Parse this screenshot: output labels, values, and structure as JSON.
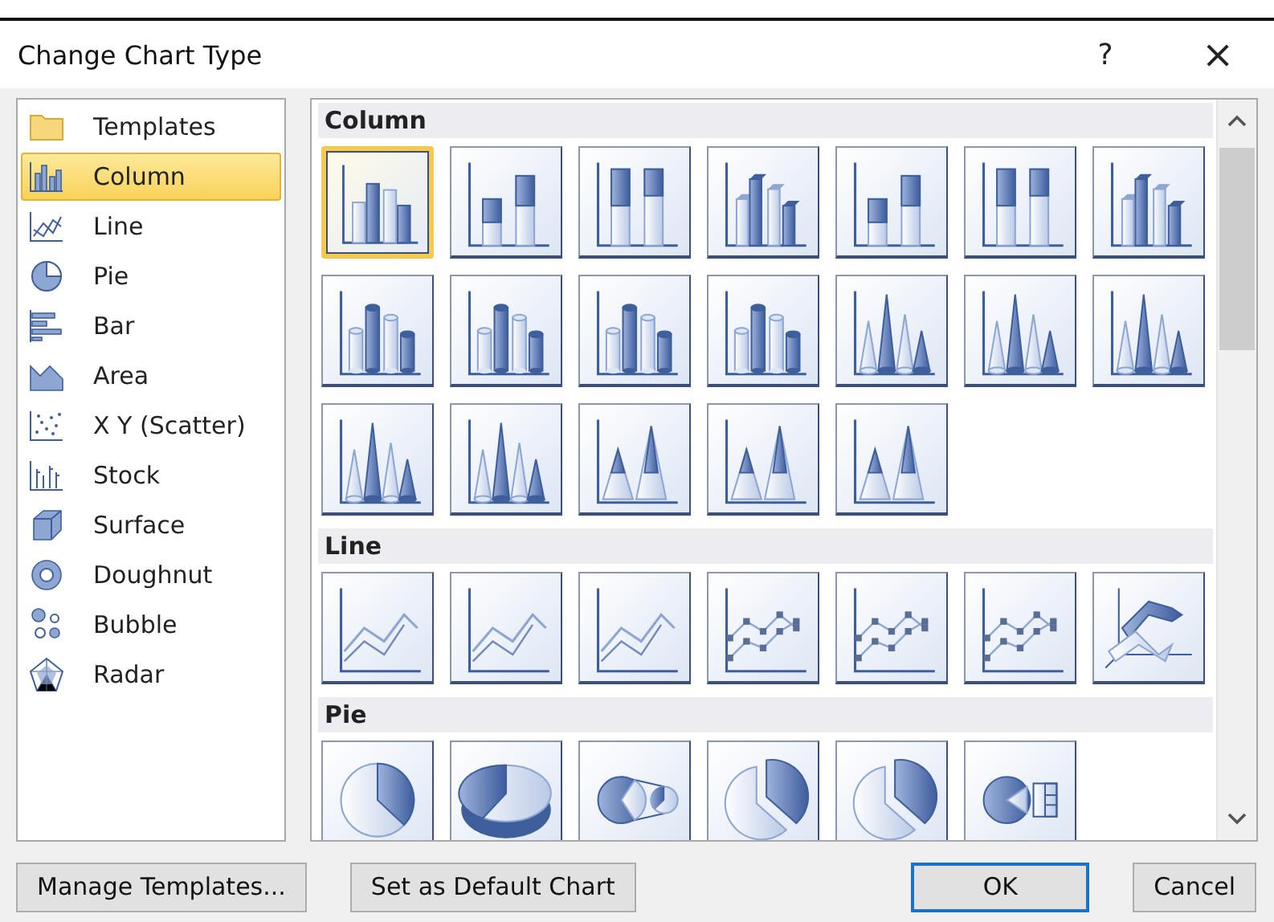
{
  "window": {
    "title": "Change Chart Type",
    "help": "?",
    "close": "×"
  },
  "sidebar": {
    "items": [
      {
        "label": "Templates",
        "kind": "templates",
        "selected": false
      },
      {
        "label": "Column",
        "kind": "column",
        "selected": true
      },
      {
        "label": "Line",
        "kind": "line",
        "selected": false
      },
      {
        "label": "Pie",
        "kind": "pie",
        "selected": false
      },
      {
        "label": "Bar",
        "kind": "bar",
        "selected": false
      },
      {
        "label": "Area",
        "kind": "area",
        "selected": false
      },
      {
        "label": "X Y (Scatter)",
        "kind": "scatter",
        "selected": false
      },
      {
        "label": "Stock",
        "kind": "stock",
        "selected": false
      },
      {
        "label": "Surface",
        "kind": "surface",
        "selected": false
      },
      {
        "label": "Doughnut",
        "kind": "doughnut",
        "selected": false
      },
      {
        "label": "Bubble",
        "kind": "bubble",
        "selected": false
      },
      {
        "label": "Radar",
        "kind": "radar",
        "selected": false
      }
    ]
  },
  "gallery": [
    {
      "title": "Column",
      "items": [
        {
          "kind": "column",
          "selected": true
        },
        {
          "kind": "stackedcolumn",
          "selected": false
        },
        {
          "kind": "fullcolumn",
          "selected": false
        },
        {
          "kind": "column3d",
          "selected": false
        },
        {
          "kind": "stackedcolumn",
          "selected": false
        },
        {
          "kind": "fullcolumn",
          "selected": false
        },
        {
          "kind": "column3d",
          "selected": false
        },
        {
          "kind": "cylinder",
          "selected": false
        },
        {
          "kind": "cylinder",
          "selected": false
        },
        {
          "kind": "cylinder",
          "selected": false
        },
        {
          "kind": "cylinder",
          "selected": false
        },
        {
          "kind": "cone",
          "selected": false
        },
        {
          "kind": "cone",
          "selected": false
        },
        {
          "kind": "cone",
          "selected": false
        },
        {
          "kind": "cone",
          "selected": false
        },
        {
          "kind": "cone",
          "selected": false
        },
        {
          "kind": "pyramid",
          "selected": false
        },
        {
          "kind": "pyramid",
          "selected": false
        },
        {
          "kind": "pyramid",
          "selected": false
        }
      ]
    },
    {
      "title": "Line",
      "items": [
        {
          "kind": "line",
          "selected": false
        },
        {
          "kind": "line",
          "selected": false
        },
        {
          "kind": "line",
          "selected": false
        },
        {
          "kind": "markerline",
          "selected": false
        },
        {
          "kind": "markerline",
          "selected": false
        },
        {
          "kind": "markerline",
          "selected": false
        },
        {
          "kind": "line3d",
          "selected": false
        }
      ]
    },
    {
      "title": "Pie",
      "items": [
        {
          "kind": "pie",
          "selected": false
        },
        {
          "kind": "pie3d",
          "selected": false
        },
        {
          "kind": "pieofpie",
          "selected": false
        },
        {
          "kind": "explodedpie",
          "selected": false
        },
        {
          "kind": "explodedpie",
          "selected": false
        },
        {
          "kind": "barofpie",
          "selected": false
        }
      ]
    }
  ],
  "buttons": [
    {
      "label": "Manage Templates...",
      "kind": "normal"
    },
    {
      "label": "Set as Default Chart",
      "kind": "normal"
    },
    {
      "label": "OK",
      "kind": "default"
    },
    {
      "label": "Cancel",
      "kind": "normal"
    }
  ]
}
